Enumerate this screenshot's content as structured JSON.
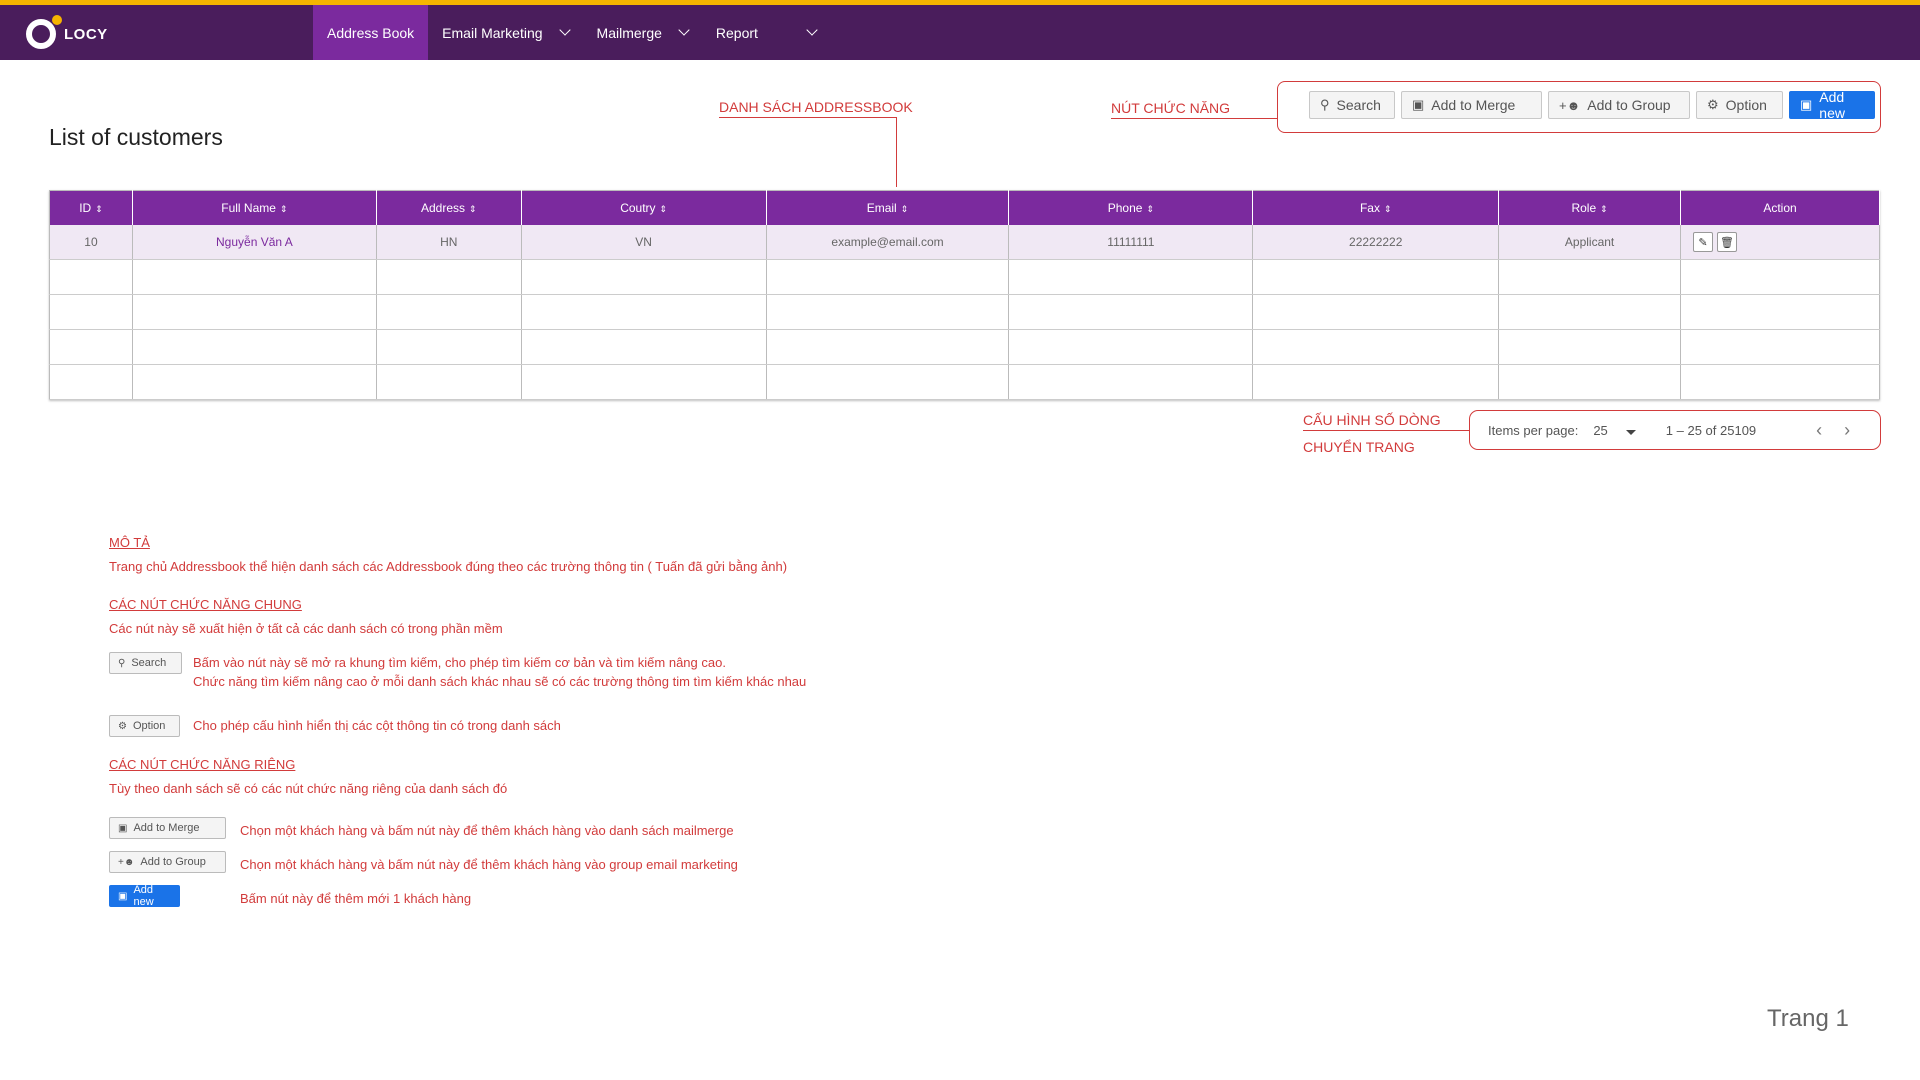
{
  "app": {
    "logo_text": "LOCY"
  },
  "nav": [
    {
      "label": "Address Book",
      "active": true,
      "has_caret": false
    },
    {
      "label": "Email Marketing",
      "active": false,
      "has_caret": true
    },
    {
      "label": "Mailmerge",
      "active": false,
      "has_caret": true
    },
    {
      "label": "Report",
      "active": false,
      "has_caret": true
    }
  ],
  "page_title": "List of customers",
  "annotations": {
    "addressbook_list": "DANH SÁCH ADDRESSBOOK",
    "function_buttons": "NÚT CHỨC NĂNG",
    "rows_config": "CẤU HÌNH SỐ DÒNG",
    "page_navigation": "CHUYỂN TRANG"
  },
  "toolbar": {
    "search": "Search",
    "add_to_merge": "Add to Merge",
    "add_to_group": "Add to Group",
    "option": "Option",
    "add_new": "Add new"
  },
  "table": {
    "columns": [
      "ID",
      "Full Name",
      "Address",
      "Coutry",
      "Email",
      "Phone",
      "Fax",
      "Role",
      "Action"
    ],
    "rows": [
      [
        "10",
        "Nguyễn Văn A",
        "HN",
        "VN",
        "example@email.com",
        "11111111",
        "22222222",
        "Applicant"
      ]
    ],
    "empty_rows": 4
  },
  "paginator": {
    "items_per_page_label": "Items per page:",
    "items_per_page": "25",
    "range": "1 – 25 of 25109"
  },
  "description": {
    "mota_title": "MÔ TẢ",
    "mota_text": "Trang chủ Addressbook thể hiện danh sách các Addressbook đúng theo các trường thông tin ( Tuấn đã gửi bằng ảnh)",
    "common_title": "CÁC NÚT CHỨC NĂNG CHUNG",
    "common_text": "Các nút này sẽ xuất hiện ở tất cả các danh sách có trong phần mềm",
    "search_line1": "Bấm vào nút này sẽ mở ra khung tìm kiếm,  cho phép tìm kiếm cơ bản và tìm kiếm nâng cao.",
    "search_line2": "Chức năng tìm kiếm nâng cao ở mỗi danh sách khác nhau sẽ có các trường thông tim tìm kiếm khác nhau",
    "option_text": "Cho phép cấu hình hiển thị các cột thông tin có trong danh sách",
    "specific_title": "CÁC NÚT CHỨC NĂNG RIÊNG",
    "specific_text": "Tùy theo danh sách sẽ có các nút chức năng riêng của danh sách đó",
    "merge_text": "Chọn một khách hàng và bấm nút này để thêm khách hàng vào danh sách mailmerge",
    "group_text": "Chọn một khách hàng và bấm nút này để thêm khách hàng vào group email marketing",
    "addnew_text": "Bấm nút này để thêm mới 1 khách hàng"
  },
  "footer": {
    "page_label": "Trang 1"
  },
  "colors": {
    "topbar": "#4a1d5c",
    "accent_purple": "#7b2a9e",
    "annotation_red": "#d23b3b",
    "primary_blue": "#1a73e8",
    "top_border": "#f5b400"
  }
}
